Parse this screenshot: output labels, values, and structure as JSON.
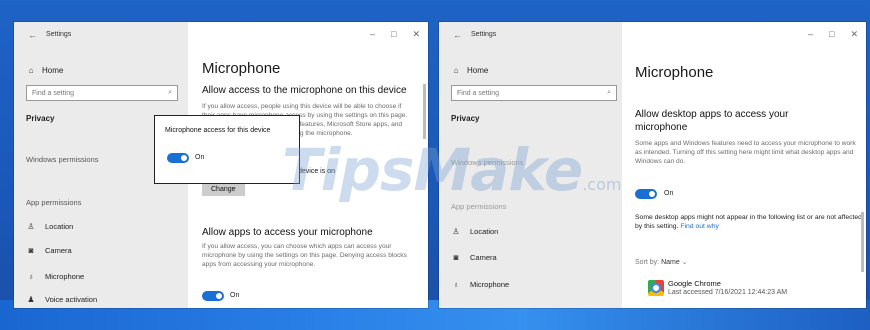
{
  "left_window": {
    "titlebar": {
      "back": "←",
      "title": "Settings",
      "controls": [
        "–",
        "□",
        "✕"
      ]
    },
    "sidebar": {
      "home": "Home",
      "search_placeholder": "Find a setting",
      "privacy": "Privacy",
      "windows_permissions": "Windows permissions",
      "app_permissions": "App permissions",
      "items": [
        {
          "icon": "location-icon",
          "label": "Location"
        },
        {
          "icon": "camera-icon",
          "label": "Camera"
        },
        {
          "icon": "microphone-icon",
          "label": "Microphone"
        },
        {
          "icon": "voice-activation-icon",
          "label": "Voice activation"
        }
      ]
    },
    "main": {
      "title": "Microphone",
      "section1_heading": "Allow access to the microphone on this device",
      "section1_text": "If you allow access, people using this device will be able to choose if their apps have microphone access by using the settings on this page. Denying access blocks Windows features, Microsoft Store apps, and most desktop apps from accessing the microphone.",
      "device_status": "device is on",
      "change_button": "Change",
      "section2_heading": "Allow apps to access your microphone",
      "section2_text": "If you allow access, you can choose which apps can access your microphone by using the settings on this page. Denying access blocks apps from accessing your microphone.",
      "toggle_label": "On"
    },
    "popup": {
      "text": "Microphone access for this device",
      "toggle_label": "On"
    }
  },
  "right_window": {
    "titlebar": {
      "back": "←",
      "title": "Settings",
      "controls": [
        "–",
        "□",
        "✕"
      ]
    },
    "sidebar": {
      "home": "Home",
      "search_placeholder": "Find a setting",
      "privacy": "Privacy",
      "windows_permissions": "Windows permissions",
      "app_permissions": "App permissions",
      "items": [
        {
          "icon": "location-icon",
          "label": "Location"
        },
        {
          "icon": "camera-icon",
          "label": "Camera"
        },
        {
          "icon": "microphone-icon",
          "label": "Microphone"
        }
      ]
    },
    "main": {
      "title": "Microphone",
      "heading": "Allow desktop apps to access your microphone",
      "text": "Some apps and Windows features need to access your microphone to work as intended. Turning off this setting here might limit what desktop apps and Windows can do.",
      "toggle_label": "On",
      "note": "Some desktop apps might not appear in the following list or are not affected by this setting.",
      "note_link": "Find out why",
      "sort_label": "Sort by:",
      "sort_value": "Name",
      "app": {
        "name": "Google Chrome",
        "last_accessed": "Last accessed 7/16/2021 12:44:23 AM"
      }
    }
  },
  "watermark": {
    "text": "TipsMake",
    "suffix": ".com"
  },
  "colors": {
    "accent": "#1a6fd4",
    "sidebar_bg": "#ebebeb",
    "desktop": "#1e63c6"
  }
}
